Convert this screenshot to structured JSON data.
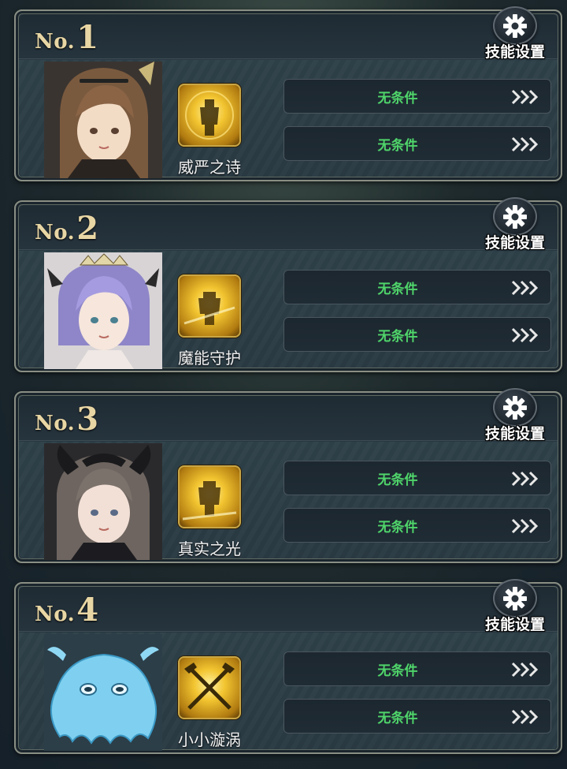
{
  "settings_label": "技能设置",
  "rank_prefix": "No.",
  "cards": [
    {
      "rank": "1",
      "skill_name": "威严之诗",
      "conditions": [
        "无条件",
        "无条件"
      ]
    },
    {
      "rank": "2",
      "skill_name": "魔能守护",
      "conditions": [
        "无条件",
        "无条件"
      ]
    },
    {
      "rank": "3",
      "skill_name": "真实之光",
      "conditions": [
        "无条件",
        "无条件"
      ]
    },
    {
      "rank": "4",
      "skill_name": "小小漩涡",
      "conditions": [
        "无条件",
        "无条件"
      ]
    }
  ],
  "colors": {
    "condition_text": "#4fd46a",
    "rank_gold": "#e8d6a4",
    "card_border": "#8a8f84"
  },
  "icons": {
    "settings": "gear-icon",
    "forward": "triple-chevron-right-icon"
  }
}
